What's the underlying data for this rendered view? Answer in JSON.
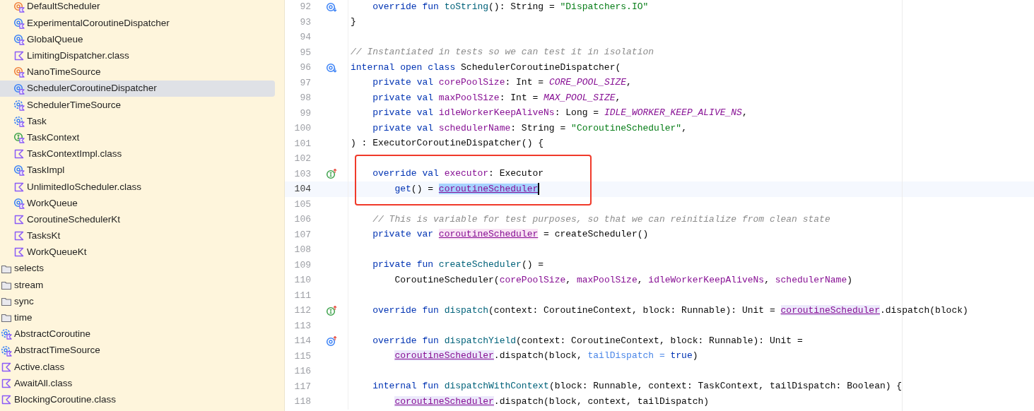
{
  "project_tree": {
    "scrolled_group": {
      "children": [
        {
          "label": "DefaultScheduler",
          "kind": "object",
          "selected": false
        },
        {
          "label": "ExperimentalCoroutineDispatcher",
          "kind": "class",
          "selected": false
        },
        {
          "label": "GlobalQueue",
          "kind": "class",
          "selected": false
        },
        {
          "label": "LimitingDispatcher.class",
          "kind": "kotlin-file",
          "selected": false
        },
        {
          "label": "NanoTimeSource",
          "kind": "object",
          "selected": false
        },
        {
          "label": "SchedulerCoroutineDispatcher",
          "kind": "class",
          "selected": true
        },
        {
          "label": "SchedulerTimeSource",
          "kind": "abstract",
          "selected": false
        },
        {
          "label": "Task",
          "kind": "abstract",
          "selected": false
        },
        {
          "label": "TaskContext",
          "kind": "interface",
          "selected": false
        },
        {
          "label": "TaskContextImpl.class",
          "kind": "kotlin-file",
          "selected": false
        },
        {
          "label": "TaskImpl",
          "kind": "class",
          "selected": false
        },
        {
          "label": "UnlimitedIoScheduler.class",
          "kind": "kotlin-file",
          "selected": false
        },
        {
          "label": "WorkQueue",
          "kind": "class",
          "selected": false
        },
        {
          "label": "CoroutineSchedulerKt",
          "kind": "kotlin-file",
          "selected": false
        },
        {
          "label": "TasksKt",
          "kind": "kotlin-file",
          "selected": false
        },
        {
          "label": "WorkQueueKt",
          "kind": "kotlin-file",
          "selected": false
        }
      ]
    },
    "items": [
      {
        "label": "selects",
        "kind": "folder",
        "selected": false
      },
      {
        "label": "stream",
        "kind": "folder",
        "selected": false
      },
      {
        "label": "sync",
        "kind": "folder",
        "selected": false
      },
      {
        "label": "time",
        "kind": "folder",
        "selected": false
      },
      {
        "label": "AbstractCoroutine",
        "kind": "abstract",
        "selected": false
      },
      {
        "label": "AbstractTimeSource",
        "kind": "abstract",
        "selected": false
      },
      {
        "label": "Active.class",
        "kind": "kotlin-file",
        "selected": false
      },
      {
        "label": "AwaitAll.class",
        "kind": "kotlin-file",
        "selected": false
      },
      {
        "label": "BlockingCoroutine.class",
        "kind": "kotlin-file",
        "selected": false
      }
    ]
  },
  "editor": {
    "lines": [
      {
        "number": "92",
        "gutter_mark": {
          "kind": "overridden"
        },
        "current": false,
        "tokens": [
          {
            "kind": "kw",
            "t": "    override fun "
          },
          {
            "kind": "fn",
            "t": "toString"
          },
          {
            "kind": "plain",
            "t": "(): String = "
          },
          {
            "kind": "str",
            "t": "\"Dispatchers.IO\""
          }
        ]
      },
      {
        "number": "93",
        "current": false,
        "tokens": [
          {
            "kind": "plain",
            "t": "}"
          }
        ]
      },
      {
        "number": "94",
        "current": false
      },
      {
        "number": "95",
        "current": false,
        "tokens": [
          {
            "kind": "comment",
            "t": "// Instantiated in tests so we can test it in isolation"
          }
        ]
      },
      {
        "number": "96",
        "gutter_mark": {
          "kind": "overridden"
        },
        "current": false,
        "tokens": [
          {
            "kind": "kw",
            "t": "internal open class "
          },
          {
            "kind": "plain",
            "t": "SchedulerCoroutineDispatcher("
          }
        ]
      },
      {
        "number": "97",
        "current": false,
        "tokens": [
          {
            "kind": "kw",
            "t": "    private val "
          },
          {
            "kind": "prop",
            "t": "corePoolSize"
          },
          {
            "kind": "plain",
            "t": ": Int = "
          },
          {
            "kind": "const",
            "t": "CORE_POOL_SIZE"
          },
          {
            "kind": "plain",
            "t": ","
          }
        ]
      },
      {
        "number": "98",
        "current": false,
        "tokens": [
          {
            "kind": "kw",
            "t": "    private val "
          },
          {
            "kind": "prop",
            "t": "maxPoolSize"
          },
          {
            "kind": "plain",
            "t": ": Int = "
          },
          {
            "kind": "const",
            "t": "MAX_POOL_SIZE"
          },
          {
            "kind": "plain",
            "t": ","
          }
        ]
      },
      {
        "number": "99",
        "current": false,
        "tokens": [
          {
            "kind": "kw",
            "t": "    private val "
          },
          {
            "kind": "prop",
            "t": "idleWorkerKeepAliveNs"
          },
          {
            "kind": "plain",
            "t": ": Long = "
          },
          {
            "kind": "const",
            "t": "IDLE_WORKER_KEEP_ALIVE_NS"
          },
          {
            "kind": "plain",
            "t": ","
          }
        ]
      },
      {
        "number": "100",
        "current": false,
        "tokens": [
          {
            "kind": "kw",
            "t": "    private val "
          },
          {
            "kind": "prop",
            "t": "schedulerName"
          },
          {
            "kind": "plain",
            "t": ": String = "
          },
          {
            "kind": "str",
            "t": "\"CoroutineScheduler\""
          },
          {
            "kind": "plain",
            "t": ","
          }
        ]
      },
      {
        "number": "101",
        "current": false,
        "tokens": [
          {
            "kind": "plain",
            "t": ") : ExecutorCoroutineDispatcher() {"
          }
        ]
      },
      {
        "number": "102",
        "current": false
      },
      {
        "number": "103",
        "gutter_mark": {
          "kind": "implements"
        },
        "current": false,
        "tokens": [
          {
            "kind": "kw",
            "t": "    override val "
          },
          {
            "kind": "prop",
            "t": "executor"
          },
          {
            "kind": "plain",
            "t": ": Executor"
          }
        ]
      },
      {
        "number": "104",
        "current": true,
        "caret": true,
        "tokens": [
          {
            "kind": "kw",
            "t": "        get"
          },
          {
            "kind": "plain",
            "t": "() = "
          },
          {
            "kind": "ref-selected",
            "t": "coroutineScheduler"
          }
        ]
      },
      {
        "number": "105",
        "current": false
      },
      {
        "number": "106",
        "current": false,
        "tokens": [
          {
            "kind": "comment",
            "t": "    // This is variable for test purposes, so that we can reinitialize from clean state"
          }
        ]
      },
      {
        "number": "107",
        "current": false,
        "tokens": [
          {
            "kind": "kw",
            "t": "    private var "
          },
          {
            "kind": "ref-write",
            "t": "coroutineScheduler"
          },
          {
            "kind": "plain",
            "t": " = createScheduler()"
          }
        ]
      },
      {
        "number": "108",
        "current": false
      },
      {
        "number": "109",
        "current": false,
        "tokens": [
          {
            "kind": "kw",
            "t": "    private fun "
          },
          {
            "kind": "fn",
            "t": "createScheduler"
          },
          {
            "kind": "plain",
            "t": "() ="
          }
        ]
      },
      {
        "number": "110",
        "current": false,
        "tokens": [
          {
            "kind": "plain",
            "t": "        CoroutineScheduler("
          },
          {
            "kind": "prop",
            "t": "corePoolSize"
          },
          {
            "kind": "plain",
            "t": ", "
          },
          {
            "kind": "prop",
            "t": "maxPoolSize"
          },
          {
            "kind": "plain",
            "t": ", "
          },
          {
            "kind": "prop",
            "t": "idleWorkerKeepAliveNs"
          },
          {
            "kind": "plain",
            "t": ", "
          },
          {
            "kind": "prop",
            "t": "schedulerName"
          },
          {
            "kind": "plain",
            "t": ")"
          }
        ]
      },
      {
        "number": "111",
        "current": false
      },
      {
        "number": "112",
        "gutter_mark": {
          "kind": "implements"
        },
        "current": false,
        "tokens": [
          {
            "kind": "kw",
            "t": "    override fun "
          },
          {
            "kind": "fn",
            "t": "dispatch"
          },
          {
            "kind": "plain",
            "t": "(context: CoroutineContext, block: Runnable): Unit = "
          },
          {
            "kind": "ref-read",
            "t": "coroutineScheduler"
          },
          {
            "kind": "plain",
            "t": ".dispatch(block)"
          }
        ]
      },
      {
        "number": "113",
        "current": false
      },
      {
        "number": "114",
        "gutter_mark": {
          "kind": "overrides"
        },
        "current": false,
        "tokens": [
          {
            "kind": "kw",
            "t": "    override fun "
          },
          {
            "kind": "fn",
            "t": "dispatchYield"
          },
          {
            "kind": "plain",
            "t": "(context: CoroutineContext, block: Runnable): Unit ="
          }
        ]
      },
      {
        "number": "115",
        "current": false,
        "tokens": [
          {
            "kind": "ref-read",
            "t": "        coroutineScheduler"
          },
          {
            "kind": "plain",
            "t": ".dispatch(block, "
          },
          {
            "kind": "named",
            "t": "tailDispatch = "
          },
          {
            "kind": "kw",
            "t": "true"
          },
          {
            "kind": "plain",
            "t": ")"
          }
        ]
      },
      {
        "number": "116",
        "current": false
      },
      {
        "number": "117",
        "current": false,
        "tokens": [
          {
            "kind": "kw",
            "t": "    internal fun "
          },
          {
            "kind": "fn",
            "t": "dispatchWithContext"
          },
          {
            "kind": "plain",
            "t": "(block: Runnable, context: TaskContext, tailDispatch: Boolean) {"
          }
        ]
      },
      {
        "number": "118",
        "current": false,
        "tokens": [
          {
            "kind": "ref-read",
            "t": "        coroutineScheduler"
          },
          {
            "kind": "plain",
            "t": ".dispatch(block, context, tailDispatch)"
          }
        ]
      }
    ]
  }
}
